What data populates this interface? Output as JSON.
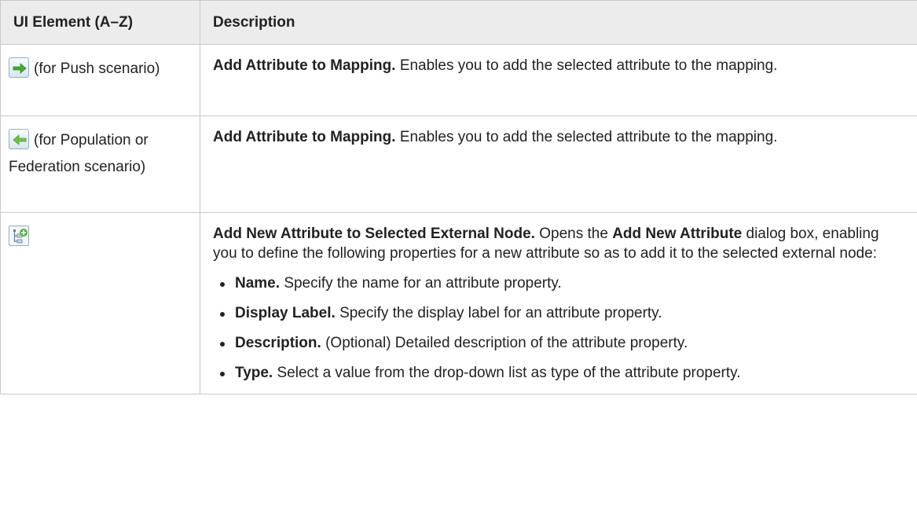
{
  "headers": [
    "UI Element (A–Z)",
    "Description"
  ],
  "rows": [
    {
      "icon": "arrow-right-icon",
      "element_suffix": "(for Push scenario)",
      "title": "Add Attribute to Mapping.",
      "text": "Enables you to add the selected attribute to the mapping."
    },
    {
      "icon": "arrow-left-icon",
      "element_suffix": "(for Population or Federation scenario)",
      "title": "Add Attribute to Mapping.",
      "text": "Enables you to add the selected attribute to the mapping."
    },
    {
      "icon": "add-attribute-icon",
      "title": "Add New Attribute to Selected External Node.",
      "text_pre": "Opens the",
      "text_bold": "Add New Attribute",
      "text_post": "dialog box, enabling you to define the following properties for a new attribute so as to add it to the selected external node:",
      "bullets": [
        {
          "label": "Name.",
          "text": "Specify the name for an attribute property."
        },
        {
          "label": "Display Label.",
          "text": "Specify the display label for an attribute property."
        },
        {
          "label": "Description.",
          "text": "(Optional) Detailed description of the attribute property."
        },
        {
          "label": "Type.",
          "text": "Select a value from the drop-down list as type of the attribute property."
        }
      ]
    }
  ],
  "colors": {
    "header_bg": "#ececec",
    "border": "#c9c9c9",
    "arrow_right": "#3fae2a",
    "arrow_left": "#6fc24a"
  }
}
